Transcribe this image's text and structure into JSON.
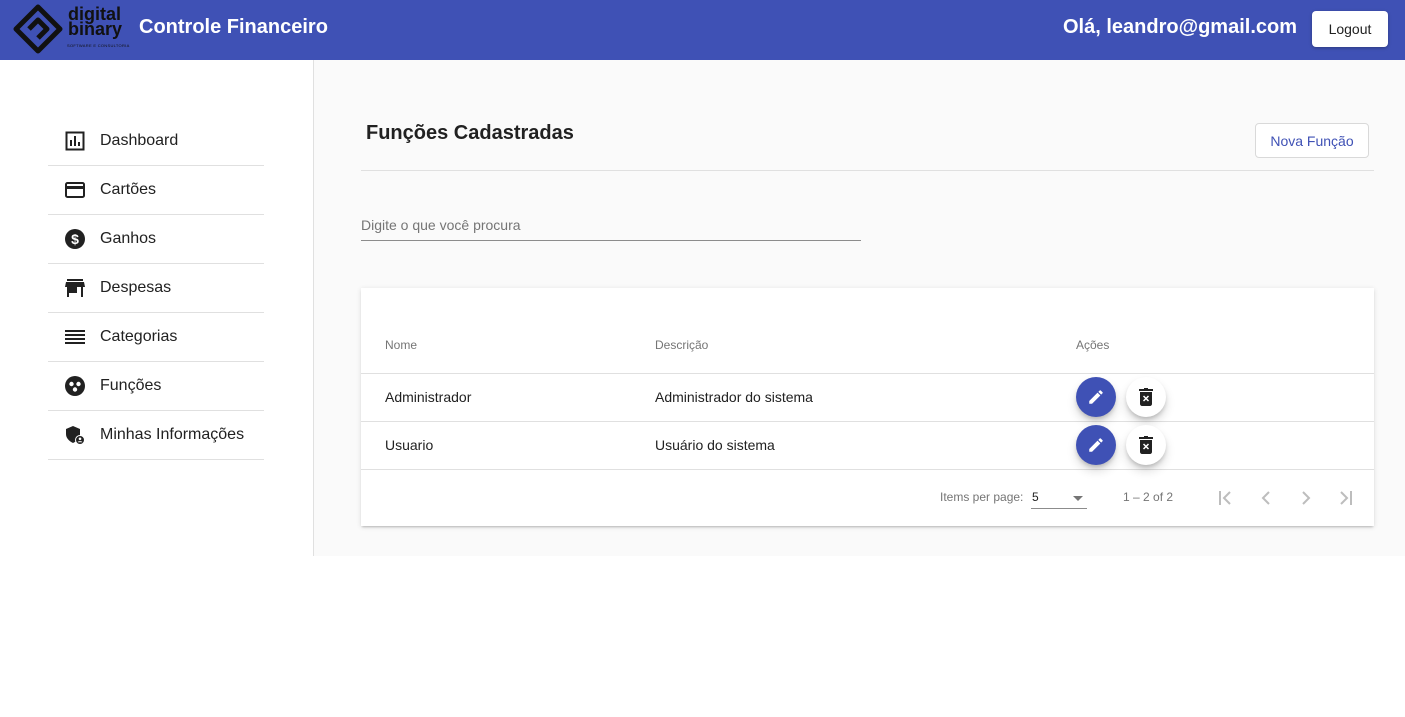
{
  "header": {
    "logo_line1": "digital",
    "logo_line2": "binary",
    "logo_sub": "SOFTWARE E CONSULTORIA",
    "app_title": "Controle Financeiro",
    "greeting": "Olá, leandro@gmail.com",
    "logout_label": "Logout",
    "background_color": "#3f51b5"
  },
  "sidebar": {
    "items": [
      {
        "label": "Dashboard",
        "icon": "bar-chart-icon"
      },
      {
        "label": "Cartões",
        "icon": "credit-card-icon"
      },
      {
        "label": "Ganhos",
        "icon": "dollar-circle-icon"
      },
      {
        "label": "Despesas",
        "icon": "store-icon"
      },
      {
        "label": "Categorias",
        "icon": "list-icon"
      },
      {
        "label": "Funções",
        "icon": "group-icon"
      },
      {
        "label": "Minhas Informações",
        "icon": "admin-shield-icon"
      }
    ]
  },
  "main": {
    "title": "Funções Cadastradas",
    "new_button_label": "Nova Função",
    "search_placeholder": "Digite o que você procura",
    "table": {
      "headers": [
        "Nome",
        "Descrição",
        "Ações"
      ],
      "rows": [
        {
          "nome": "Administrador",
          "descricao": "Administrador do sistema"
        },
        {
          "nome": "Usuario",
          "descricao": "Usuário do sistema"
        }
      ]
    },
    "paginator": {
      "items_per_page_label": "Items per page:",
      "items_per_page_value": "5",
      "range_label": "1 – 2 of 2"
    }
  },
  "colors": {
    "primary": "#3f51b5",
    "background": "#fafafa"
  }
}
